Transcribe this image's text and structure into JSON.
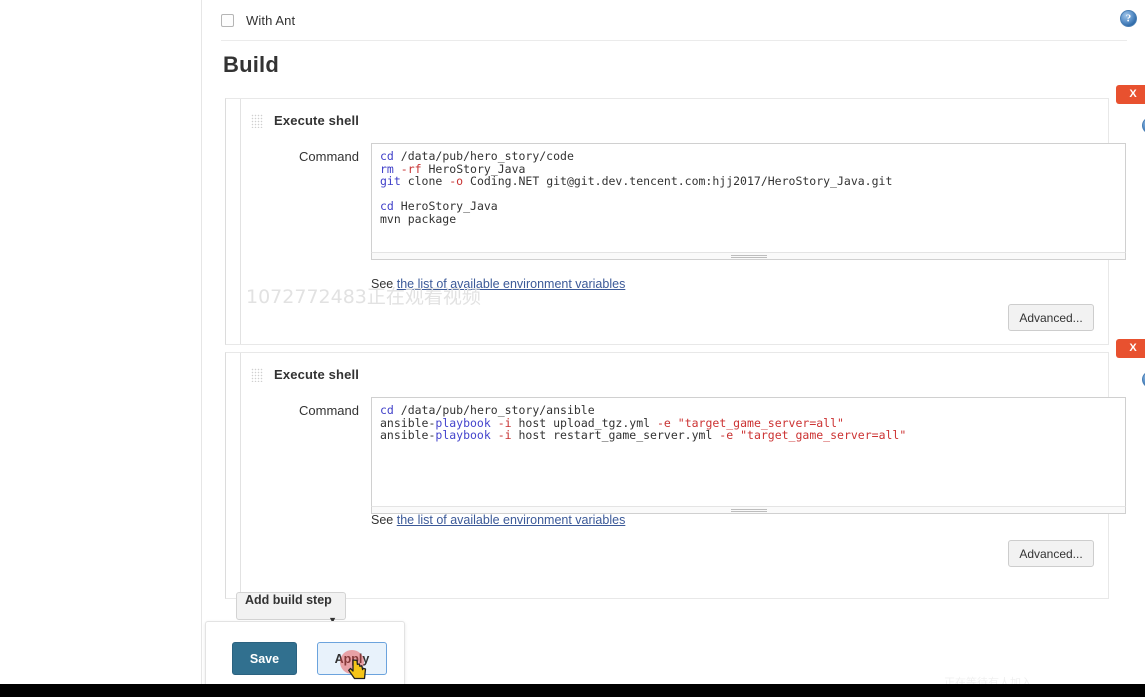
{
  "page": {
    "with_ant_label": "With Ant",
    "build_heading": "Build"
  },
  "icons": {
    "help": "help-icon",
    "grip": "drag-grip-icon",
    "caret_down": "▼",
    "close_x": "X"
  },
  "build_steps": [
    {
      "title": "Execute shell",
      "remove_label": "X",
      "command_label": "Command",
      "command_lines": [
        "cd /data/pub/hero_story/code",
        "rm -rf HeroStory_Java",
        "git clone -o Coding.NET git@git.dev.tencent.com:hjj2017/HeroStory_Java.git",
        "",
        "cd HeroStory_Java",
        "mvn package"
      ],
      "see_prefix": "See ",
      "see_link": "the list of available environment variables",
      "advanced_label": "Advanced..."
    },
    {
      "title": "Execute shell",
      "remove_label": "X",
      "command_label": "Command",
      "command_lines": [
        "cd /data/pub/hero_story/ansible",
        "ansible-playbook -i host upload_tgz.yml -e \"target_game_server=all\"",
        "ansible-playbook -i host restart_game_server.yml -e \"target_game_server=all\""
      ],
      "see_prefix": "See ",
      "see_link": "the list of available environment variables",
      "advanced_label": "Advanced..."
    }
  ],
  "add_build_step": {
    "label": "Add build step",
    "caret": "▼"
  },
  "save_bar": {
    "save_label": "Save",
    "apply_label": "Apply"
  },
  "watermarks": {
    "main": "1072772483正在观看视频",
    "ghost": "正在观看视频",
    "corner": "正在等待有人加入"
  },
  "colors": {
    "remove_button": "#e8512f",
    "save_button": "#31708f",
    "apply_button": "#e8f2fb",
    "link": "#3b5998",
    "keyword": "#3e3ec8",
    "option": "#c73232"
  }
}
